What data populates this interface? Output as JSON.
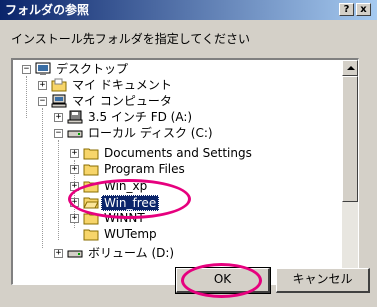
{
  "window": {
    "title": "フォルダの参照",
    "help_label": "?",
    "close_label": "x"
  },
  "instruction": "インストール先フォルダを指定してください",
  "tree": {
    "items": [
      {
        "label": "デスクトップ",
        "expander": "−",
        "icon": "desktop-icon"
      },
      {
        "label": "マイ ドキュメント",
        "expander": "+",
        "icon": "folder-icon"
      },
      {
        "label": "マイ コンピュータ",
        "expander": "−",
        "icon": "computer-icon"
      },
      {
        "label": "3.5 インチ FD (A:)",
        "expander": "+",
        "icon": "floppy-icon"
      },
      {
        "label": "ローカル ディスク (C:)",
        "expander": "−",
        "icon": "drive-icon"
      },
      {
        "label": "Documents and Settings",
        "expander": "+",
        "icon": "folder-icon"
      },
      {
        "label": "Program Files",
        "expander": "+",
        "icon": "folder-icon"
      },
      {
        "label": "Win_xp",
        "expander": "+",
        "icon": "folder-icon"
      },
      {
        "label": "Win_free",
        "expander": "+",
        "icon": "folder-icon"
      },
      {
        "label": "WINNT",
        "expander": "+",
        "icon": "folder-icon"
      },
      {
        "label": "WUTemp",
        "expander": "",
        "icon": "folder-icon"
      },
      {
        "label": "ボリューム (D:)",
        "expander": "+",
        "icon": "drive-icon"
      }
    ]
  },
  "buttons": {
    "ok_label": "OK",
    "cancel_label": "キャンセル"
  },
  "colors": {
    "title_gradient_start": "#0a246a",
    "title_gradient_end": "#a6caf0",
    "face": "#d4d0c8",
    "highlight_annotation": "#e6007e",
    "folder": "#f7d56a"
  }
}
